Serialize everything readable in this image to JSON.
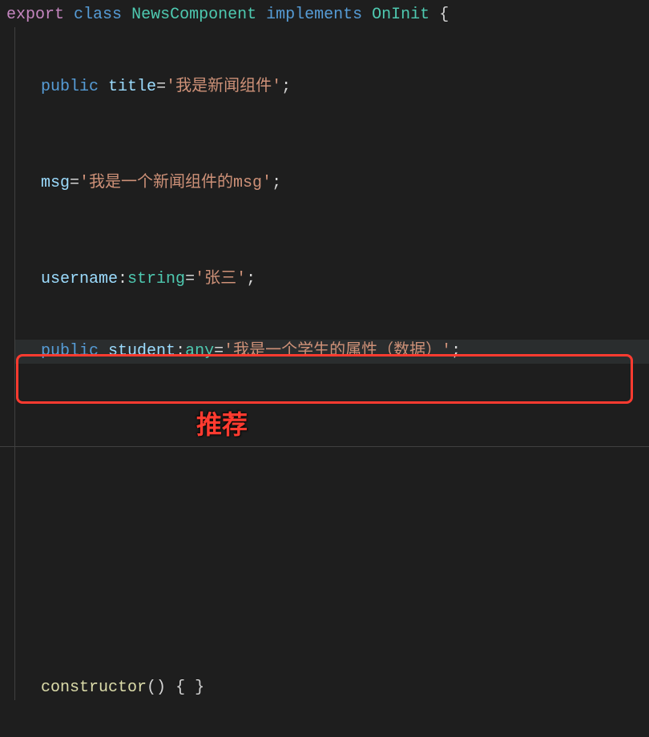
{
  "code": {
    "line1": {
      "export": "export",
      "class": "class",
      "className": "NewsComponent",
      "implements": "implements",
      "interface": "OnInit",
      "openBrace": "{"
    },
    "line_title": {
      "public": "public",
      "prop": "title",
      "eq": "=",
      "string": "'我是新闻组件'",
      "semi": ";"
    },
    "line_msg": {
      "prop": "msg",
      "eq": "=",
      "string": "'我是一个新闻组件的msg'",
      "semi": ";"
    },
    "line_username": {
      "prop": "username",
      "colon": ":",
      "type": "string",
      "eq": "=",
      "string": "'张三'",
      "semi": ";"
    },
    "line_student": {
      "public": "public",
      "prop": "student",
      "colon": ":",
      "type": "any",
      "eq": "=",
      "string": "'我是一个学生的属性（数据）'",
      "semi": ";"
    },
    "line_ctor": {
      "ctor": "constructor",
      "parens": "()",
      "braces": "{ }"
    }
  },
  "annotation": {
    "label": "推荐"
  }
}
